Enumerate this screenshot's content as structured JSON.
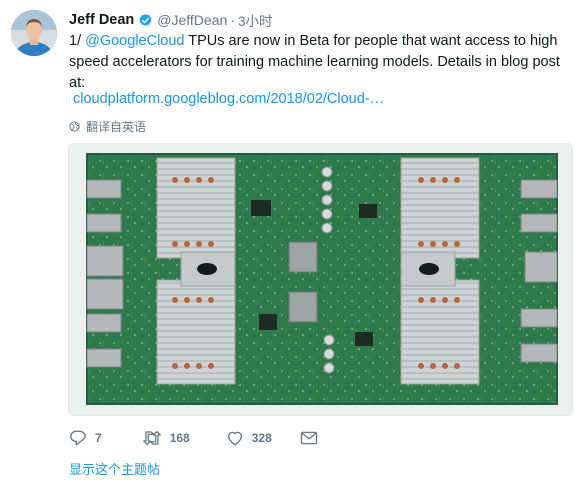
{
  "tweet": {
    "author_name": "Jeff Dean",
    "author_handle": "@JeffDean",
    "separator": "·",
    "time": "3小时",
    "text_prefix": "1/ ",
    "mention": "@GoogleCloud",
    "text_rest": " TPUs are now in Beta for people that want access to high speed accelerators for training machine learning models.  Details in blog post at:",
    "link_text": "cloudplatform.googleblog.com/2018/02/Cloud-…",
    "translate_label": "翻译自英语"
  },
  "actions": {
    "reply_count": "7",
    "retweet_count": "168",
    "like_count": "328"
  },
  "thread_link": "显示这个主题帖",
  "colors": {
    "accent": "#1b95e0",
    "secondary_text": "#657786",
    "pcb_green": "#2f7a4a"
  }
}
